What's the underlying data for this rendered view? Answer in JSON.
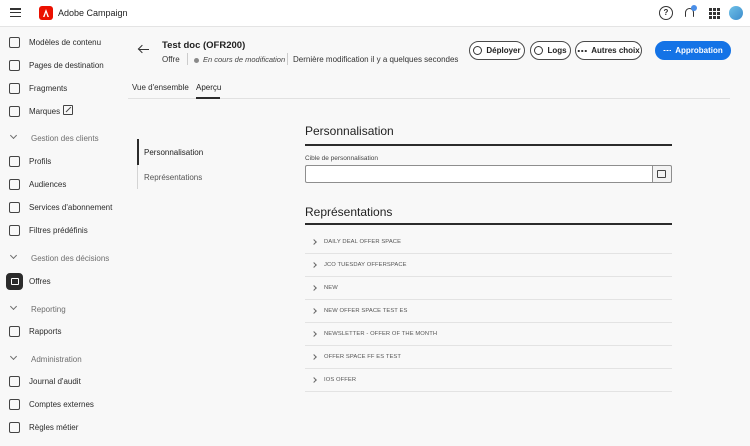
{
  "topbar": {
    "app_title": "Adobe Campaign",
    "help_glyph": "?"
  },
  "sidebar": {
    "items": [
      {
        "label": "Modèles de contenu",
        "icon": "template-icon"
      },
      {
        "label": "Pages de destination",
        "icon": "landing-page-icon"
      },
      {
        "label": "Fragments",
        "icon": "fragments-icon"
      },
      {
        "label": "Marques",
        "icon": "brand-icon"
      }
    ],
    "groups": [
      {
        "label": "Gestion des clients",
        "items": [
          {
            "label": "Profils",
            "icon": "profile-icon"
          },
          {
            "label": "Audiences",
            "icon": "audiences-icon"
          },
          {
            "label": "Services d'abonnement",
            "icon": "subscription-icon"
          },
          {
            "label": "Filtres prédéfinis",
            "icon": "filter-icon"
          }
        ]
      },
      {
        "label": "Gestion des décisions",
        "items": [
          {
            "label": "Offres",
            "icon": "offers-icon",
            "active": true
          }
        ]
      },
      {
        "label": "Reporting",
        "items": [
          {
            "label": "Rapports",
            "icon": "reports-icon"
          }
        ]
      },
      {
        "label": "Administration",
        "items": [
          {
            "label": "Journal d'audit",
            "icon": "audit-icon"
          },
          {
            "label": "Comptes externes",
            "icon": "external-accounts-icon"
          },
          {
            "label": "Règles métier",
            "icon": "business-rules-icon"
          }
        ]
      }
    ]
  },
  "header": {
    "title": "Test doc (OFR200)",
    "type": "Offre",
    "status": "En cours de modification",
    "last_modified": "Dernière modification il y a quelques secondes",
    "buttons": {
      "deploy": "Déployer",
      "logs": "Logs",
      "more": "Autres choix",
      "approve": "Approbation"
    }
  },
  "tabs": [
    {
      "label": "Vue d'ensemble",
      "active": false
    },
    {
      "label": "Aperçu",
      "active": true
    }
  ],
  "side_nav": [
    {
      "label": "Personnalisation",
      "active": true
    },
    {
      "label": "Représentations",
      "active": false
    }
  ],
  "personalization": {
    "title": "Personnalisation",
    "field_label": "Cible de personnalisation",
    "field_value": ""
  },
  "representations": {
    "title": "Représentations",
    "items": [
      "DAILY DEAL OFFER SPACE",
      "JCO TUESDAY OFFERSPACE",
      "NEW",
      "NEW OFFER SPACE TEST ES",
      "NEWSLETTER - OFFER OF THE MONTH",
      "OFFER SPACE FF ES TEST",
      "IOS OFFER"
    ]
  },
  "colors": {
    "accent": "#1473e6",
    "brand": "#eb1000",
    "notification": "#4a8ee8"
  }
}
